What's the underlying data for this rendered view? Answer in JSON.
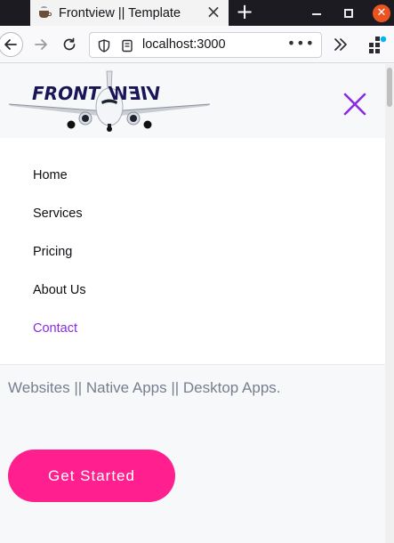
{
  "browser": {
    "tab_title": "Frontview || Template",
    "tab_close": "×",
    "new_tab": "+",
    "url": "localhost:3000",
    "url_menu": "•••"
  },
  "site": {
    "logo_text_left": "FRONT",
    "logo_text_right": "VIEW"
  },
  "menu": {
    "items": [
      {
        "label": "Home",
        "active": false
      },
      {
        "label": "Services",
        "active": false
      },
      {
        "label": "Pricing",
        "active": false
      },
      {
        "label": "About Us",
        "active": false
      },
      {
        "label": "Contact",
        "active": true
      }
    ]
  },
  "hero": {
    "subtitle": "Websites || Native Apps || Desktop Apps.",
    "cta_label": "Get Started"
  },
  "colors": {
    "accent_purple": "#8a2be2",
    "cta_pink": "#ff1f8e",
    "logo_navy": "#1b1557"
  }
}
